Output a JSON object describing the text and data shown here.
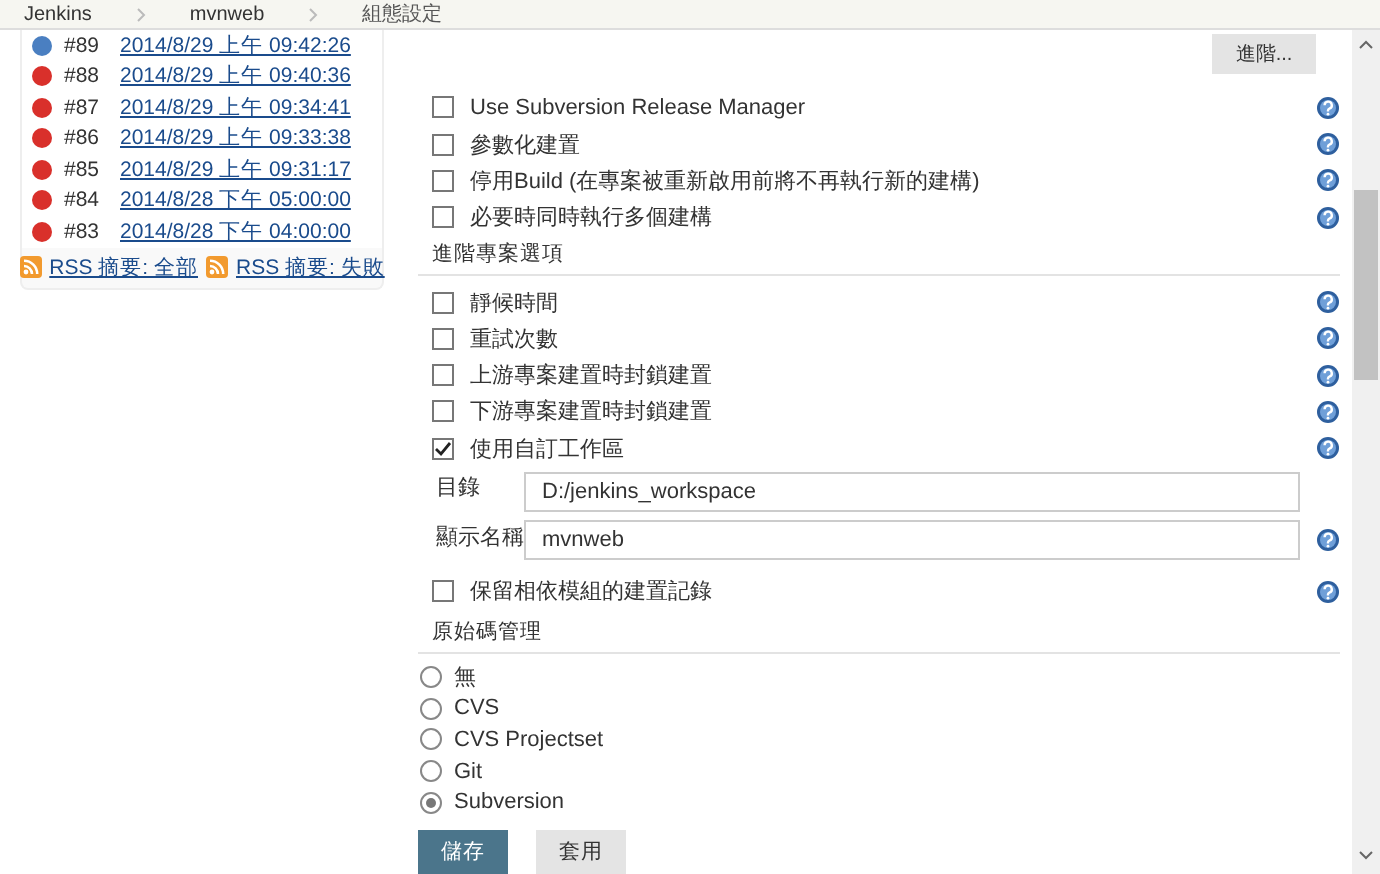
{
  "breadcrumb": [
    "Jenkins",
    "mvnweb",
    "組態設定"
  ],
  "build_history": {
    "builds": [
      {
        "number": "#89",
        "time": "2014/8/29 上午 09:42:26",
        "color": "#4a7fc1"
      },
      {
        "number": "#88",
        "time": "2014/8/29 上午 09:40:36",
        "color": "#d9302b"
      },
      {
        "number": "#87",
        "time": "2014/8/29 上午 09:34:41",
        "color": "#d9302b"
      },
      {
        "number": "#86",
        "time": "2014/8/29 上午 09:33:38",
        "color": "#d9302b"
      },
      {
        "number": "#85",
        "time": "2014/8/29 上午 09:31:17",
        "color": "#d9302b"
      },
      {
        "number": "#84",
        "time": "2014/8/28 下午 05:00:00",
        "color": "#d9302b"
      },
      {
        "number": "#83",
        "time": "2014/8/28 下午 04:00:00",
        "color": "#d9302b"
      }
    ],
    "feeds": [
      "RSS 摘要: 全部",
      "RSS 摘要: 失敗"
    ]
  },
  "advanced_button": "進階...",
  "general_options": [
    {
      "label": "Use Subversion Release Manager",
      "checked": false
    },
    {
      "label": "參數化建置",
      "checked": false
    },
    {
      "label": "停用Build (在專案被重新啟用前將不再執行新的建構)",
      "checked": false
    },
    {
      "label": "必要時同時執行多個建構",
      "checked": false
    }
  ],
  "advanced_section": {
    "title": "進階專案選項",
    "options": [
      {
        "label": "靜候時間",
        "checked": false
      },
      {
        "label": "重試次數",
        "checked": false
      },
      {
        "label": "上游專案建置時封鎖建置",
        "checked": false
      },
      {
        "label": "下游專案建置時封鎖建置",
        "checked": false
      },
      {
        "label": "使用自訂工作區",
        "checked": true
      }
    ],
    "fields": [
      {
        "label": "目錄",
        "value": "D:/jenkins_workspace",
        "help": false
      },
      {
        "label": "顯示名稱",
        "value": "mvnweb",
        "help": true
      }
    ],
    "more_options": [
      {
        "label": "保留相依模組的建置記錄",
        "checked": false
      }
    ]
  },
  "scm_section": {
    "title": "原始碼管理",
    "options": [
      {
        "label": "無",
        "selected": false
      },
      {
        "label": "CVS",
        "selected": false
      },
      {
        "label": "CVS Projectset",
        "selected": false
      },
      {
        "label": "Git",
        "selected": false
      },
      {
        "label": "Subversion",
        "selected": true
      }
    ]
  },
  "buttons": [
    {
      "label": "儲存",
      "kind": "primary"
    },
    {
      "label": "套用",
      "kind": "secondary"
    }
  ]
}
